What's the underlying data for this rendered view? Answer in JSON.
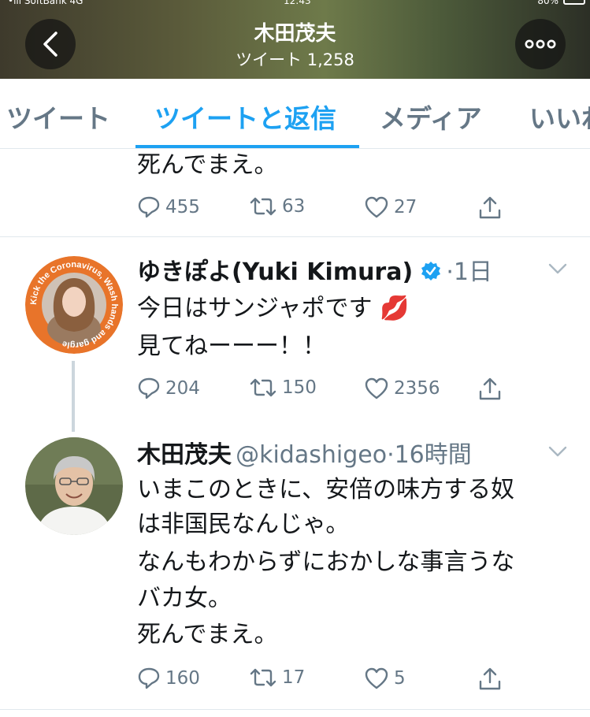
{
  "status_bar": {
    "carrier": "•ııl SoftBank 4G",
    "time": "12:43",
    "battery": "80%"
  },
  "header": {
    "title": "木田茂夫",
    "subtitle": "ツイート 1,258"
  },
  "tabs": [
    {
      "label": "ツイート",
      "active": false
    },
    {
      "label": "ツイートと返信",
      "active": true
    },
    {
      "label": "メディア",
      "active": false
    },
    {
      "label": "いいね",
      "active": false
    }
  ],
  "tweet_prev": {
    "text": "死んでまえ。",
    "replies": "455",
    "retweets": "63",
    "likes": "27"
  },
  "tweet_yuki": {
    "display_name": "ゆきぽよ(Yuki Kimura)",
    "verified": true,
    "time": "·1日",
    "avatar_ring_text": "Kick the Coronavirus, Wash hands and gargle",
    "lines": [
      "今日はサンジャポです 💋",
      "見てねーーー！！"
    ],
    "replies": "204",
    "retweets": "150",
    "likes": "2356"
  },
  "tweet_kida": {
    "display_name": "木田茂夫",
    "handle": "@kidashigeo",
    "time": "·16時間",
    "lines": [
      "いまこのときに、安倍の味方する奴",
      "は非国民なんじゃ。",
      "なんもわからずにおかしな事言うな",
      "バカ女。",
      "死んでまえ。"
    ],
    "replies": "160",
    "retweets": "17",
    "likes": "5"
  },
  "colors": {
    "accent": "#1da1f2",
    "muted": "#657786",
    "text": "#14171a",
    "divider": "#e1e8ed",
    "ring_orange": "#e8742a"
  }
}
